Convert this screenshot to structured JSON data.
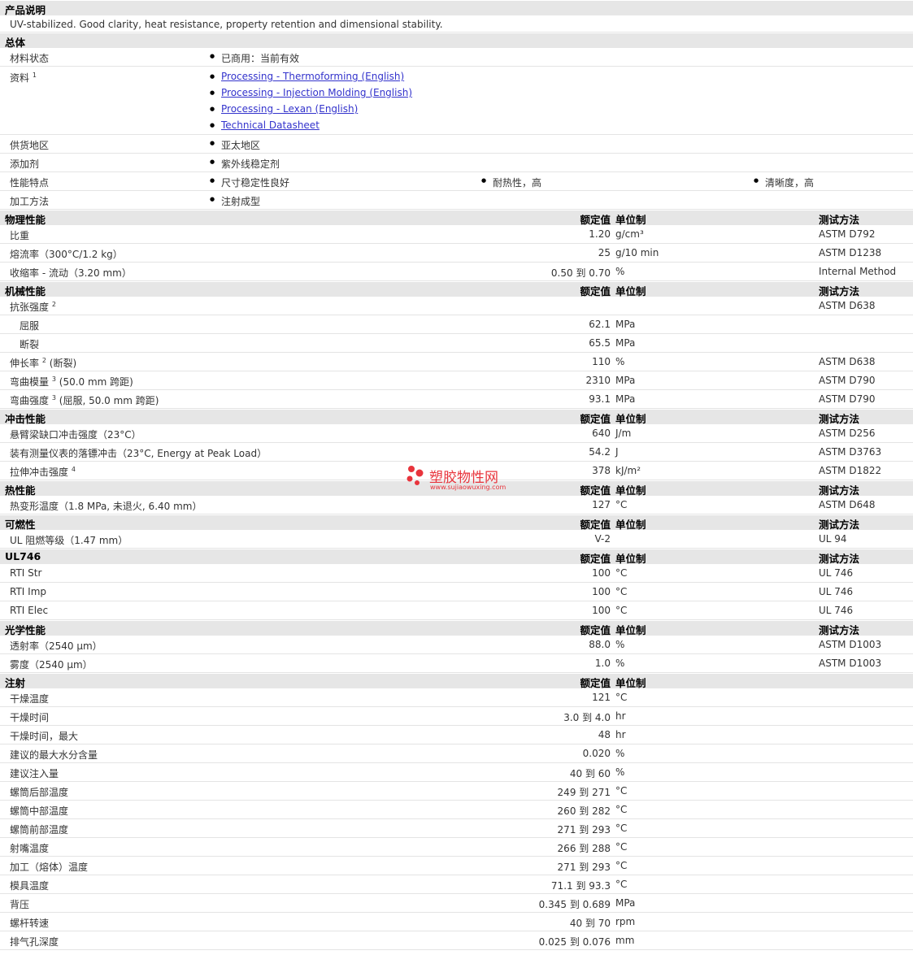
{
  "desc_header": "产品说明",
  "description": "UV-stabilized. Good clarity, heat resistance, property retention and dimensional stability.",
  "general": {
    "title": "总体",
    "status_label": "材料状态",
    "status_value": "已商用：当前有效",
    "docs_label": "资料",
    "docs_sup": "1",
    "docs": [
      "Processing - Thermoforming (English)",
      "Processing - Injection Molding (English)",
      "Processing - Lexan (English)",
      "Technical Datasheet"
    ],
    "region_label": "供货地区",
    "region_value": "亚太地区",
    "additive_label": "添加剂",
    "additive_value": "紫外线稳定剂",
    "features_label": "性能特点",
    "features": [
      "尺寸稳定性良好",
      "耐热性，高",
      "清晰度，高"
    ],
    "method_label": "加工方法",
    "method_value": "注射成型"
  },
  "col_headers": {
    "value": "额定值",
    "unit": "单位制",
    "method": "测试方法"
  },
  "sections": [
    {
      "title": "物理性能",
      "method_col": true,
      "rows": [
        {
          "label": "比重",
          "value": "1.20",
          "unit": "g/cm³",
          "method": "ASTM D792"
        },
        {
          "label": "熔流率（300°C/1.2 kg）",
          "value": "25",
          "unit": "g/10 min",
          "method": "ASTM D1238"
        },
        {
          "label": "收缩率 - 流动（3.20 mm）",
          "value": "0.50 到  0.70",
          "unit": "%",
          "method": "Internal Method"
        }
      ]
    },
    {
      "title": "机械性能",
      "method_col": true,
      "rows": [
        {
          "label": "抗张强度",
          "sup": "2",
          "value": "",
          "unit": "",
          "method": "ASTM D638"
        },
        {
          "label": "屈服",
          "indent": true,
          "value": "62.1",
          "unit": "MPa",
          "method": ""
        },
        {
          "label": "断裂",
          "indent": true,
          "value": "65.5",
          "unit": "MPa",
          "method": ""
        },
        {
          "label": "伸长率",
          "sup": "2",
          "suffix": "(断裂)",
          "value": "110",
          "unit": "%",
          "method": "ASTM D638"
        },
        {
          "label": "弯曲模量",
          "sup": "3",
          "suffix": "(50.0 mm 跨距)",
          "value": "2310",
          "unit": "MPa",
          "method": "ASTM D790"
        },
        {
          "label": "弯曲强度",
          "sup": "3",
          "suffix": "(屈服, 50.0 mm 跨距)",
          "value": "93.1",
          "unit": "MPa",
          "method": "ASTM D790"
        }
      ]
    },
    {
      "title": "冲击性能",
      "method_col": true,
      "rows": [
        {
          "label": "悬臂梁缺口冲击强度（23°C）",
          "value": "640",
          "unit": "J/m",
          "method": "ASTM D256"
        },
        {
          "label": "装有测量仪表的落镖冲击（23°C, Energy at Peak Load）",
          "value": "54.2",
          "unit": "J",
          "method": "ASTM D3763"
        },
        {
          "label": "拉伸冲击强度",
          "sup": "4",
          "value": "378",
          "unit": "kJ/m²",
          "method": "ASTM D1822"
        }
      ]
    },
    {
      "title": "热性能",
      "method_col": true,
      "rows": [
        {
          "label": "热变形温度（1.8 MPa, 未退火, 6.40 mm）",
          "value": "127",
          "unit": "°C",
          "method": "ASTM D648"
        }
      ]
    },
    {
      "title": "可燃性",
      "method_col": true,
      "rows": [
        {
          "label": "UL 阻燃等级（1.47 mm）",
          "value": "V-2",
          "unit": "",
          "method": "UL 94"
        }
      ]
    },
    {
      "title": "UL746",
      "method_col": true,
      "rows": [
        {
          "label": "RTI Str",
          "value": "100",
          "unit": "°C",
          "method": "UL 746"
        },
        {
          "label": "RTI Imp",
          "value": "100",
          "unit": "°C",
          "method": "UL 746"
        },
        {
          "label": "RTI Elec",
          "value": "100",
          "unit": "°C",
          "method": "UL 746"
        }
      ]
    },
    {
      "title": "光学性能",
      "method_col": true,
      "rows": [
        {
          "label": "透射率（2540 µm）",
          "value": "88.0",
          "unit": "%",
          "method": "ASTM D1003"
        },
        {
          "label": "雾度（2540 µm）",
          "value": "1.0",
          "unit": "%",
          "method": "ASTM D1003"
        }
      ]
    },
    {
      "title": "注射",
      "method_col": false,
      "rows": [
        {
          "label": "干燥温度",
          "value": "121",
          "unit": "°C",
          "method": ""
        },
        {
          "label": "干燥时间",
          "value": "3.0 到  4.0",
          "unit": "hr",
          "method": ""
        },
        {
          "label": "干燥时间，最大",
          "value": "48",
          "unit": "hr",
          "method": ""
        },
        {
          "label": "建议的最大水分含量",
          "value": "0.020",
          "unit": "%",
          "method": ""
        },
        {
          "label": "建议注入量",
          "value": "40 到  60",
          "unit": "%",
          "method": ""
        },
        {
          "label": "螺筒后部温度",
          "value": "249 到  271",
          "unit": "°C",
          "method": ""
        },
        {
          "label": "螺筒中部温度",
          "value": "260 到  282",
          "unit": "°C",
          "method": ""
        },
        {
          "label": "螺筒前部温度",
          "value": "271 到  293",
          "unit": "°C",
          "method": ""
        },
        {
          "label": "射嘴温度",
          "value": "266 到  288",
          "unit": "°C",
          "method": ""
        },
        {
          "label": "加工（熔体）温度",
          "value": "271 到  293",
          "unit": "°C",
          "method": ""
        },
        {
          "label": "模具温度",
          "value": "71.1 到  93.3",
          "unit": "°C",
          "method": ""
        },
        {
          "label": "背压",
          "value": "0.345 到  0.689",
          "unit": "MPa",
          "method": ""
        },
        {
          "label": "螺杆转速",
          "value": "40 到  70",
          "unit": "rpm",
          "method": ""
        },
        {
          "label": "排气孔深度",
          "value": "0.025 到  0.076",
          "unit": "mm",
          "method": ""
        }
      ]
    }
  ],
  "watermark": {
    "name": "塑胶物性网",
    "url": "www.sujiaowuxing.com",
    "color": "#e8343c"
  }
}
